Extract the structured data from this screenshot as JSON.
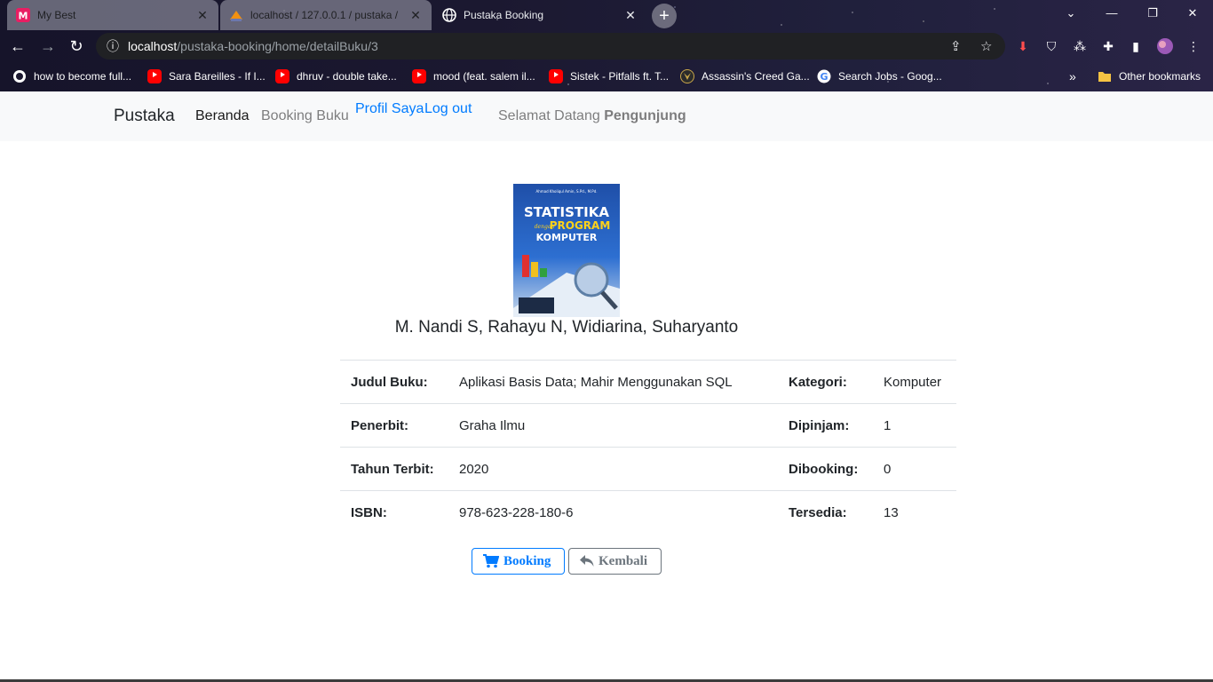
{
  "browser": {
    "tabs": [
      {
        "label": "My Best",
        "icon": "m-app-icon"
      },
      {
        "label": "localhost / 127.0.0.1 / pustaka / ",
        "icon": "phpmyadmin-icon"
      },
      {
        "label": "Pustaka Booking",
        "icon": "globe-icon"
      }
    ],
    "url_host": "localhost",
    "url_path": "/pustaka-booking/home/detailBuku/3",
    "bookmarks": [
      {
        "label": "how to become full...",
        "icon": "globe-icon"
      },
      {
        "label": "Sara Bareilles - If I...",
        "icon": "youtube-icon"
      },
      {
        "label": "dhruv - double take...",
        "icon": "youtube-icon"
      },
      {
        "label": "mood (feat. salem il...",
        "icon": "youtube-icon"
      },
      {
        "label": "Sistek - Pitfalls ft. T...",
        "icon": "youtube-icon"
      },
      {
        "label": "Assassin's Creed Ga...",
        "icon": "assassins-icon"
      },
      {
        "label": "Search Jobs - Goog...",
        "icon": "google-icon"
      }
    ],
    "bookmarks_overflow": "»",
    "other_bookmarks": "Other bookmarks"
  },
  "navbar": {
    "brand": "Pustaka",
    "links": [
      "Beranda",
      "Booking Buku",
      "Profil Saya",
      "Log out"
    ],
    "welcome_prefix": "Selamat Datang",
    "welcome_user": "Pengunjung"
  },
  "book": {
    "cover": {
      "title_line1": "STATISTIKA",
      "title_line2": "dengan",
      "title_line3": "PROGRAM",
      "title_line4": "KOMPUTER",
      "author_line": "Ahmad Kholiqul Amin, S.Pd., M.Pd."
    },
    "authors": "M. Nandi S, Rahayu N, Widiarina, Suharyanto",
    "rows": [
      {
        "label_left": "Judul Buku:",
        "value_left": "Aplikasi Basis Data; Mahir Menggunakan SQL",
        "label_right": "Kategori:",
        "value_right": "Komputer"
      },
      {
        "label_left": "Penerbit:",
        "value_left": "Graha Ilmu",
        "label_right": "Dipinjam:",
        "value_right": "1"
      },
      {
        "label_left": "Tahun Terbit:",
        "value_left": "2020",
        "label_right": "Dibooking:",
        "value_right": "0"
      },
      {
        "label_left": "ISBN:",
        "value_left": "978-623-228-180-6",
        "label_right": "Tersedia:",
        "value_right": "13"
      }
    ]
  },
  "actions": {
    "booking": "Booking",
    "kembali": "Kembali"
  },
  "colors": {
    "primary": "#007bff",
    "secondary": "#6c757d",
    "navbar_bg": "#f8f9fa"
  }
}
